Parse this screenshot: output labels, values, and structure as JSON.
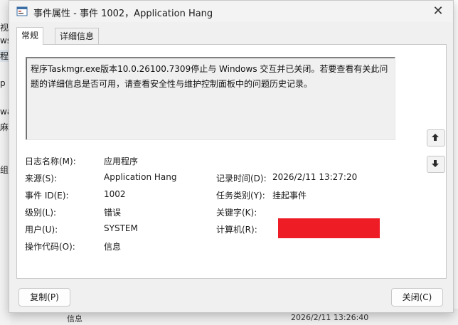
{
  "title": "事件属性 - 事件 1002，Application Hang",
  "tabs": [
    "常规",
    "详细信息"
  ],
  "description": "程序Taskmgr.exe版本10.0.26100.7309停止与 Windows 交互并已关闭。若要查看有关此问题的详细信息是否可用，请查看安全性与维护控制面板中的问题历史记录。",
  "fields": {
    "log_name_label": "日志名称(M):",
    "log_name_value": "应用程序",
    "source_label": "来源(S):",
    "source_value": "Application Hang",
    "event_id_label": "事件 ID(E):",
    "event_id_value": "1002",
    "level_label": "级别(L):",
    "level_value": "错误",
    "user_label": "用户(U):",
    "user_value": "SYSTEM",
    "opcode_label": "操作代码(O):",
    "opcode_value": "信息",
    "logged_label": "记录时间(D):",
    "logged_value": "2026/2/11 13:27:20",
    "category_label": "任务类别(Y):",
    "category_value": "挂起事件",
    "keywords_label": "关键字(K):",
    "keywords_value": "",
    "computer_label": "计算机(R):",
    "computer_value": ""
  },
  "buttons": {
    "copy": "复制(P)",
    "close": "关闭(C)"
  },
  "background": {
    "left_fragments": [
      "视图",
      "ws",
      "程",
      "p",
      "wa",
      "麻",
      "组"
    ],
    "row_name": "信息",
    "row_date": "2026/2/11 13:26:40"
  },
  "colors": {
    "redaction": "#ee1c25",
    "dialog_bg": "#f0f0f0"
  },
  "icons": {
    "title": "event-viewer-icon",
    "up": "arrow-up-icon",
    "down": "arrow-down-icon",
    "close": "close-icon"
  }
}
